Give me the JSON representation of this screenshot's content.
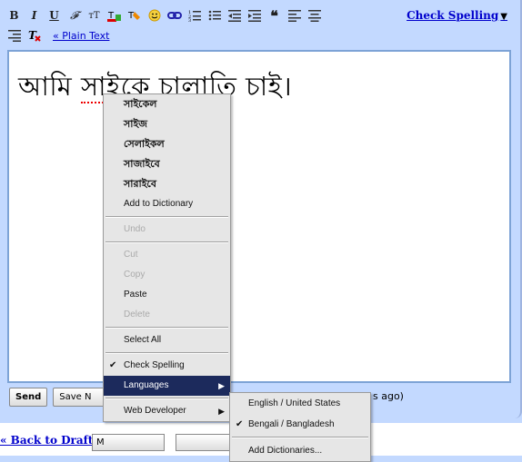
{
  "toolbar": {
    "check_spelling": "Check Spelling",
    "plain_text": "« Plain Text"
  },
  "editor": {
    "text_before": "আমি ",
    "misspelled_word": "সাইকে",
    "text_after": " চালাতি চাই।"
  },
  "buttons": {
    "send": "Send",
    "save_now": "Save N"
  },
  "status": {
    "autosave": "s ago)"
  },
  "lower": {
    "back_to_drafts": "« Back to Drafts",
    "move_btn": "M"
  },
  "context_menu": {
    "suggestions": [
      "সাইকেল",
      "সাইজ",
      "সেলাইকল",
      "সাজাইবে",
      "সারাইবে"
    ],
    "add_to_dictionary": "Add to Dictionary",
    "undo": "Undo",
    "cut": "Cut",
    "copy": "Copy",
    "paste": "Paste",
    "delete": "Delete",
    "select_all": "Select All",
    "check_spelling": "Check Spelling",
    "languages": "Languages",
    "web_developer": "Web Developer"
  },
  "languages_menu": {
    "items": [
      "English / United States",
      "Bengali / Bangladesh"
    ],
    "add_dictionaries": "Add Dictionaries..."
  }
}
